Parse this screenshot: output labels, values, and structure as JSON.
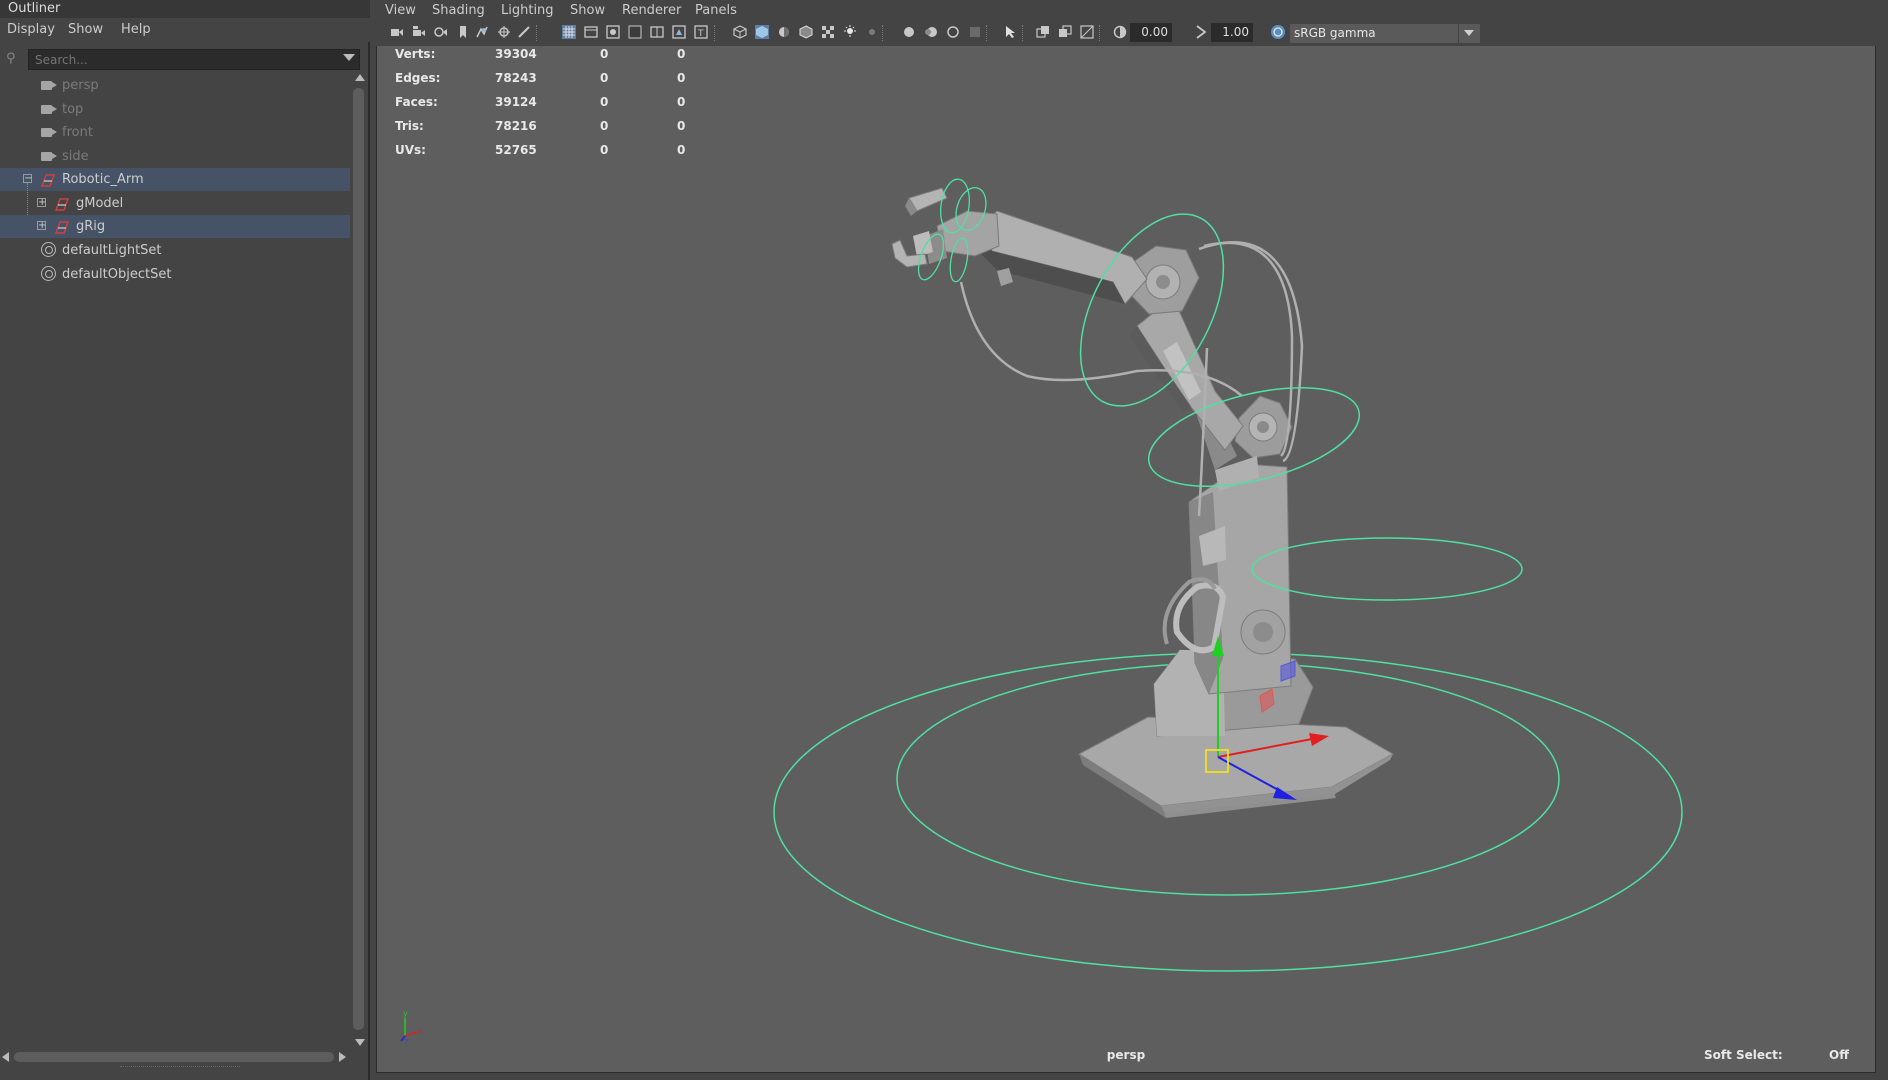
{
  "outliner": {
    "title": "Outliner",
    "menu": [
      "Display",
      "Show",
      "Help"
    ],
    "search_placeholder": "Search...",
    "items": [
      {
        "label": "persp",
        "type": "camera"
      },
      {
        "label": "top",
        "type": "camera"
      },
      {
        "label": "front",
        "type": "camera"
      },
      {
        "label": "side",
        "type": "camera"
      },
      {
        "label": "Robotic_Arm",
        "type": "group",
        "selected": true,
        "expanded": true
      },
      {
        "label": "gModel",
        "type": "group",
        "selected": false,
        "expanded": false
      },
      {
        "label": "gRig",
        "type": "group",
        "selected": true,
        "expanded": false
      },
      {
        "label": "defaultLightSet",
        "type": "set"
      },
      {
        "label": "defaultObjectSet",
        "type": "set"
      }
    ]
  },
  "viewport": {
    "menu": [
      "View",
      "Shading",
      "Lighting",
      "Show",
      "Renderer",
      "Panels"
    ],
    "toolbar": {
      "exposure": "0.00",
      "gamma": "1.00",
      "color_space": "sRGB gamma"
    },
    "hud": {
      "rows": [
        {
          "label": "Verts:",
          "v1": "39304",
          "v2": "0",
          "v3": "0"
        },
        {
          "label": "Edges:",
          "v1": "78243",
          "v2": "0",
          "v3": "0"
        },
        {
          "label": "Faces:",
          "v1": "39124",
          "v2": "0",
          "v3": "0"
        },
        {
          "label": "Tris:",
          "v1": "78216",
          "v2": "0",
          "v3": "0"
        },
        {
          "label": "UVs:",
          "v1": "52765",
          "v2": "0",
          "v3": "0"
        }
      ]
    },
    "camera_name": "persp",
    "soft_select_label": "Soft Select:",
    "soft_select_value": "Off",
    "colors": {
      "background": "#5e5e5e",
      "control_curve": "#4fe0a2",
      "x_axis": "#e02020",
      "y_axis": "#20d020",
      "z_axis": "#2020e0",
      "mesh": "#a0a0a0"
    }
  }
}
